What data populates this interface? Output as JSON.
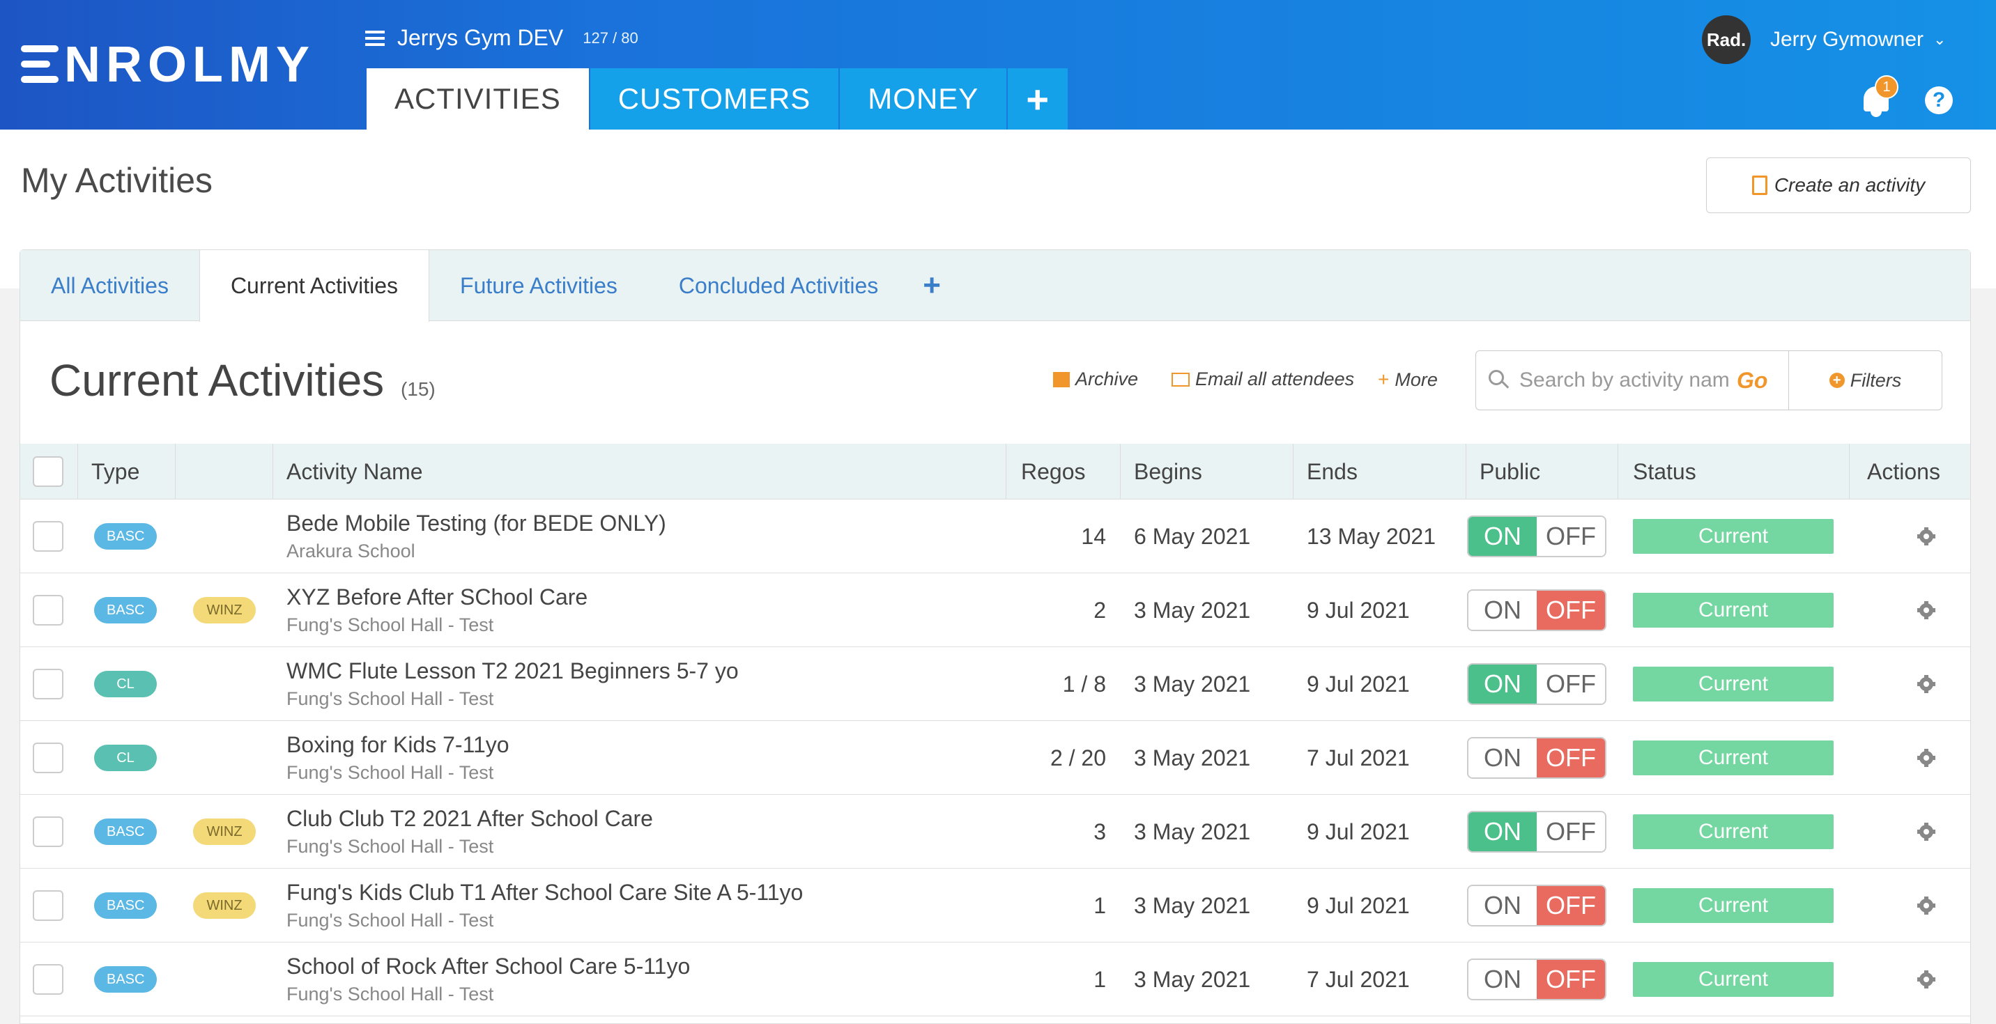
{
  "header": {
    "logo": "ENROLMY",
    "workspace_name": "Jerrys Gym DEV",
    "workspace_count": "127 / 80",
    "tabs": [
      {
        "label": "ACTIVITIES",
        "active": true
      },
      {
        "label": "CUSTOMERS",
        "active": false
      },
      {
        "label": "MONEY",
        "active": false
      }
    ],
    "add_tab_label": "+",
    "user": {
      "avatar_text": "Rad.",
      "name": "Jerry Gymowner"
    },
    "notification_count": "1",
    "help_label": "?"
  },
  "page": {
    "title": "My Activities",
    "create_button": "Create an activity"
  },
  "subtabs": [
    {
      "label": "All Activities",
      "active": false
    },
    {
      "label": "Current Activities",
      "active": true
    },
    {
      "label": "Future Activities",
      "active": false
    },
    {
      "label": "Concluded Activities",
      "active": false
    }
  ],
  "subtab_add": "+",
  "section": {
    "title": "Current Activities",
    "count": "(15)",
    "archive": "Archive",
    "email": "Email all attendees",
    "more": "More",
    "search_placeholder": "Search by activity name",
    "go": "Go",
    "filters": "Filters"
  },
  "columns": {
    "type": "Type",
    "name": "Activity Name",
    "regos": "Regos",
    "begins": "Begins",
    "ends": "Ends",
    "public": "Public",
    "status": "Status",
    "actions": "Actions"
  },
  "toggle_labels": {
    "on": "ON",
    "off": "OFF"
  },
  "rows": [
    {
      "type": "BASC",
      "type_kind": "basc",
      "tag": "",
      "name": "Bede Mobile Testing (for BEDE ONLY)",
      "venue": "Arakura School",
      "regos": "14",
      "begins": "6 May 2021",
      "ends": "13 May 2021",
      "public": true,
      "status": "Current"
    },
    {
      "type": "BASC",
      "type_kind": "basc",
      "tag": "WINZ",
      "name": "XYZ Before After SChool Care",
      "venue": "Fung's School Hall - Test",
      "regos": "2",
      "begins": "3 May 2021",
      "ends": "9 Jul 2021",
      "public": false,
      "status": "Current"
    },
    {
      "type": "CL",
      "type_kind": "cl",
      "tag": "",
      "name": "WMC Flute Lesson T2 2021 Beginners 5-7 yo",
      "venue": "Fung's School Hall - Test",
      "regos": "1 / 8",
      "begins": "3 May 2021",
      "ends": "9 Jul 2021",
      "public": true,
      "status": "Current"
    },
    {
      "type": "CL",
      "type_kind": "cl",
      "tag": "",
      "name": "Boxing for Kids 7-11yo",
      "venue": "Fung's School Hall - Test",
      "regos": "2 / 20",
      "begins": "3 May 2021",
      "ends": "7 Jul 2021",
      "public": false,
      "status": "Current"
    },
    {
      "type": "BASC",
      "type_kind": "basc",
      "tag": "WINZ",
      "name": "Club Club T2 2021 After School Care",
      "venue": "Fung's School Hall - Test",
      "regos": "3",
      "begins": "3 May 2021",
      "ends": "9 Jul 2021",
      "public": true,
      "status": "Current"
    },
    {
      "type": "BASC",
      "type_kind": "basc",
      "tag": "WINZ",
      "name": "Fung's Kids Club T1 After School Care Site A 5-11yo",
      "venue": "Fung's School Hall - Test",
      "regos": "1",
      "begins": "3 May 2021",
      "ends": "9 Jul 2021",
      "public": false,
      "status": "Current"
    },
    {
      "type": "BASC",
      "type_kind": "basc",
      "tag": "",
      "name": "School of Rock After School Care 5-11yo",
      "venue": "Fung's School Hall - Test",
      "regos": "1",
      "begins": "3 May 2021",
      "ends": "7 Jul 2021",
      "public": false,
      "status": "Current"
    }
  ],
  "colors": {
    "header_start": "#1d55c4",
    "header_end": "#1591e6",
    "accent_orange": "#f0962b",
    "on_green": "#4cc08b",
    "off_red": "#e96a5f",
    "status_green": "#74d6a0"
  }
}
